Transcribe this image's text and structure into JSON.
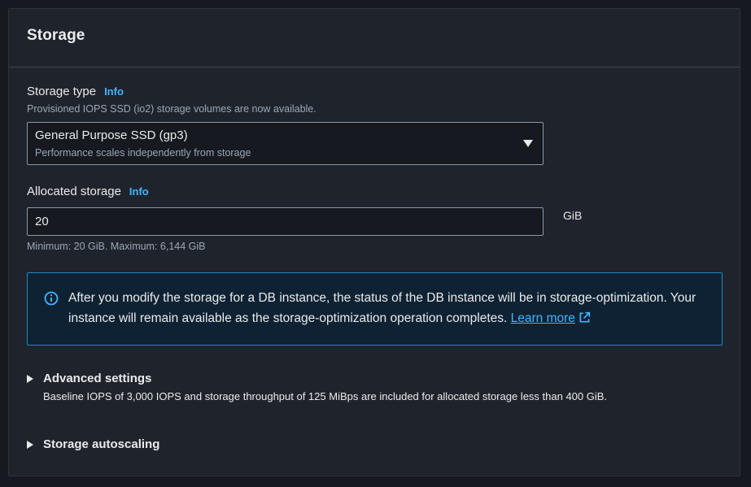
{
  "section": {
    "title": "Storage"
  },
  "storage_type": {
    "label": "Storage type",
    "info_label": "Info",
    "description": "Provisioned IOPS SSD (io2) storage volumes are now available.",
    "selected_value": "General Purpose SSD (gp3)",
    "selected_description": "Performance scales independently from storage"
  },
  "allocated_storage": {
    "label": "Allocated storage",
    "info_label": "Info",
    "value": "20",
    "unit": "GiB",
    "constraint": "Minimum: 20 GiB. Maximum: 6,144 GiB"
  },
  "alert": {
    "text": "After you modify the storage for a DB instance, the status of the DB instance will be in storage-optimization. Your instance will remain available as the storage-optimization operation completes.",
    "link_label": "Learn more",
    "color": "#42b4ff"
  },
  "advanced_settings": {
    "title": "Advanced settings",
    "description": "Baseline IOPS of 3,000 IOPS and storage throughput of 125 MiBps are included for allocated storage less than 400 GiB."
  },
  "storage_autoscaling": {
    "title": "Storage autoscaling"
  },
  "icons": {
    "info": "info-circle-icon",
    "external": "external-link-icon",
    "caret": "caret-down-icon",
    "expand": "triangle-right-icon"
  }
}
